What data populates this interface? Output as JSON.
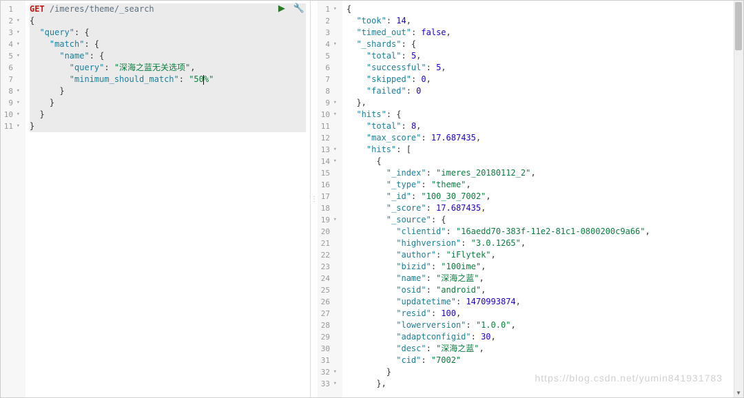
{
  "left": {
    "toolbar": {
      "play": "▶",
      "wrench": "🔧"
    },
    "lines": [
      {
        "n": 1,
        "fold": "",
        "tokens": [
          [
            "method",
            "GET"
          ],
          [
            "text",
            " "
          ],
          [
            "path",
            "/imeres/theme/_search"
          ]
        ]
      },
      {
        "n": 2,
        "fold": "▾",
        "tokens": [
          [
            "punct",
            "{"
          ]
        ]
      },
      {
        "n": 3,
        "fold": "▾",
        "tokens": [
          [
            "text",
            "  "
          ],
          [
            "key",
            "\"query\""
          ],
          [
            "punct",
            ": {"
          ]
        ]
      },
      {
        "n": 4,
        "fold": "▾",
        "tokens": [
          [
            "text",
            "    "
          ],
          [
            "key",
            "\"match\""
          ],
          [
            "punct",
            ": {"
          ]
        ]
      },
      {
        "n": 5,
        "fold": "▾",
        "tokens": [
          [
            "text",
            "      "
          ],
          [
            "key",
            "\"name\""
          ],
          [
            "punct",
            ": {"
          ]
        ]
      },
      {
        "n": 6,
        "fold": "",
        "tokens": [
          [
            "text",
            "        "
          ],
          [
            "key",
            "\"query\""
          ],
          [
            "punct",
            ": "
          ],
          [
            "qstr",
            "\"深海之蓝无关选项\""
          ],
          [
            "punct",
            ","
          ]
        ]
      },
      {
        "n": 7,
        "fold": "",
        "cursor": true,
        "tokens": [
          [
            "text",
            "        "
          ],
          [
            "key",
            "\"minimum_should_match\""
          ],
          [
            "punct",
            ": "
          ],
          [
            "qstr",
            "\"50"
          ],
          [
            "cursor",
            ""
          ],
          [
            "qstr",
            "%\""
          ]
        ]
      },
      {
        "n": 8,
        "fold": "▾",
        "tokens": [
          [
            "text",
            "      "
          ],
          [
            "punct",
            "}"
          ]
        ]
      },
      {
        "n": 9,
        "fold": "▾",
        "tokens": [
          [
            "text",
            "    "
          ],
          [
            "punct",
            "}"
          ]
        ]
      },
      {
        "n": 10,
        "fold": "▾",
        "tokens": [
          [
            "text",
            "  "
          ],
          [
            "punct",
            "}"
          ]
        ]
      },
      {
        "n": 11,
        "fold": "▾",
        "tokens": [
          [
            "punct",
            "}"
          ]
        ]
      }
    ]
  },
  "right": {
    "lines": [
      {
        "n": 1,
        "fold": "▾",
        "tokens": [
          [
            "punct",
            "{"
          ]
        ]
      },
      {
        "n": 2,
        "fold": "",
        "tokens": [
          [
            "text",
            "  "
          ],
          [
            "key",
            "\"took\""
          ],
          [
            "punct",
            ": "
          ],
          [
            "num",
            "14"
          ],
          [
            "punct",
            ","
          ]
        ]
      },
      {
        "n": 3,
        "fold": "",
        "tokens": [
          [
            "text",
            "  "
          ],
          [
            "key",
            "\"timed_out\""
          ],
          [
            "punct",
            ": "
          ],
          [
            "bool",
            "false"
          ],
          [
            "punct",
            ","
          ]
        ]
      },
      {
        "n": 4,
        "fold": "▾",
        "tokens": [
          [
            "text",
            "  "
          ],
          [
            "key",
            "\"_shards\""
          ],
          [
            "punct",
            ": {"
          ]
        ]
      },
      {
        "n": 5,
        "fold": "",
        "tokens": [
          [
            "text",
            "    "
          ],
          [
            "key",
            "\"total\""
          ],
          [
            "punct",
            ": "
          ],
          [
            "num",
            "5"
          ],
          [
            "punct",
            ","
          ]
        ]
      },
      {
        "n": 6,
        "fold": "",
        "tokens": [
          [
            "text",
            "    "
          ],
          [
            "key",
            "\"successful\""
          ],
          [
            "punct",
            ": "
          ],
          [
            "num",
            "5"
          ],
          [
            "punct",
            ","
          ]
        ]
      },
      {
        "n": 7,
        "fold": "",
        "tokens": [
          [
            "text",
            "    "
          ],
          [
            "key",
            "\"skipped\""
          ],
          [
            "punct",
            ": "
          ],
          [
            "num",
            "0"
          ],
          [
            "punct",
            ","
          ]
        ]
      },
      {
        "n": 8,
        "fold": "",
        "tokens": [
          [
            "text",
            "    "
          ],
          [
            "key",
            "\"failed\""
          ],
          [
            "punct",
            ": "
          ],
          [
            "num",
            "0"
          ]
        ]
      },
      {
        "n": 9,
        "fold": "▾",
        "tokens": [
          [
            "text",
            "  "
          ],
          [
            "punct",
            "},"
          ]
        ]
      },
      {
        "n": 10,
        "fold": "▾",
        "tokens": [
          [
            "text",
            "  "
          ],
          [
            "key",
            "\"hits\""
          ],
          [
            "punct",
            ": {"
          ]
        ]
      },
      {
        "n": 11,
        "fold": "",
        "tokens": [
          [
            "text",
            "    "
          ],
          [
            "key",
            "\"total\""
          ],
          [
            "punct",
            ": "
          ],
          [
            "num",
            "8"
          ],
          [
            "punct",
            ","
          ]
        ]
      },
      {
        "n": 12,
        "fold": "",
        "tokens": [
          [
            "text",
            "    "
          ],
          [
            "key",
            "\"max_score\""
          ],
          [
            "punct",
            ": "
          ],
          [
            "num",
            "17.687435"
          ],
          [
            "punct",
            ","
          ]
        ]
      },
      {
        "n": 13,
        "fold": "▾",
        "tokens": [
          [
            "text",
            "    "
          ],
          [
            "key",
            "\"hits\""
          ],
          [
            "punct",
            ": ["
          ]
        ]
      },
      {
        "n": 14,
        "fold": "▾",
        "tokens": [
          [
            "text",
            "      "
          ],
          [
            "punct",
            "{"
          ]
        ]
      },
      {
        "n": 15,
        "fold": "",
        "tokens": [
          [
            "text",
            "        "
          ],
          [
            "key",
            "\"_index\""
          ],
          [
            "punct",
            ": "
          ],
          [
            "qstr",
            "\"imeres_20180112_2\""
          ],
          [
            "punct",
            ","
          ]
        ]
      },
      {
        "n": 16,
        "fold": "",
        "tokens": [
          [
            "text",
            "        "
          ],
          [
            "key",
            "\"_type\""
          ],
          [
            "punct",
            ": "
          ],
          [
            "qstr",
            "\"theme\""
          ],
          [
            "punct",
            ","
          ]
        ]
      },
      {
        "n": 17,
        "fold": "",
        "tokens": [
          [
            "text",
            "        "
          ],
          [
            "key",
            "\"_id\""
          ],
          [
            "punct",
            ": "
          ],
          [
            "qstr",
            "\"100_30_7002\""
          ],
          [
            "punct",
            ","
          ]
        ]
      },
      {
        "n": 18,
        "fold": "",
        "tokens": [
          [
            "text",
            "        "
          ],
          [
            "key",
            "\"_score\""
          ],
          [
            "punct",
            ": "
          ],
          [
            "num",
            "17.687435"
          ],
          [
            "punct",
            ","
          ]
        ]
      },
      {
        "n": 19,
        "fold": "▾",
        "tokens": [
          [
            "text",
            "        "
          ],
          [
            "key",
            "\"_source\""
          ],
          [
            "punct",
            ": {"
          ]
        ]
      },
      {
        "n": 20,
        "fold": "",
        "tokens": [
          [
            "text",
            "          "
          ],
          [
            "key",
            "\"clientid\""
          ],
          [
            "punct",
            ": "
          ],
          [
            "qstr",
            "\"16aedd70-383f-11e2-81c1-0800200c9a66\""
          ],
          [
            "punct",
            ","
          ]
        ]
      },
      {
        "n": 21,
        "fold": "",
        "tokens": [
          [
            "text",
            "          "
          ],
          [
            "key",
            "\"highversion\""
          ],
          [
            "punct",
            ": "
          ],
          [
            "qstr",
            "\"3.0.1265\""
          ],
          [
            "punct",
            ","
          ]
        ]
      },
      {
        "n": 22,
        "fold": "",
        "tokens": [
          [
            "text",
            "          "
          ],
          [
            "key",
            "\"author\""
          ],
          [
            "punct",
            ": "
          ],
          [
            "qstr",
            "\"iFlytek\""
          ],
          [
            "punct",
            ","
          ]
        ]
      },
      {
        "n": 23,
        "fold": "",
        "tokens": [
          [
            "text",
            "          "
          ],
          [
            "key",
            "\"bizid\""
          ],
          [
            "punct",
            ": "
          ],
          [
            "qstr",
            "\"100ime\""
          ],
          [
            "punct",
            ","
          ]
        ]
      },
      {
        "n": 24,
        "fold": "",
        "tokens": [
          [
            "text",
            "          "
          ],
          [
            "key",
            "\"name\""
          ],
          [
            "punct",
            ": "
          ],
          [
            "qstr",
            "\"深海之蓝\""
          ],
          [
            "punct",
            ","
          ]
        ]
      },
      {
        "n": 25,
        "fold": "",
        "tokens": [
          [
            "text",
            "          "
          ],
          [
            "key",
            "\"osid\""
          ],
          [
            "punct",
            ": "
          ],
          [
            "qstr",
            "\"android\""
          ],
          [
            "punct",
            ","
          ]
        ]
      },
      {
        "n": 26,
        "fold": "",
        "tokens": [
          [
            "text",
            "          "
          ],
          [
            "key",
            "\"updatetime\""
          ],
          [
            "punct",
            ": "
          ],
          [
            "num",
            "1470993874"
          ],
          [
            "punct",
            ","
          ]
        ]
      },
      {
        "n": 27,
        "fold": "",
        "tokens": [
          [
            "text",
            "          "
          ],
          [
            "key",
            "\"resid\""
          ],
          [
            "punct",
            ": "
          ],
          [
            "num",
            "100"
          ],
          [
            "punct",
            ","
          ]
        ]
      },
      {
        "n": 28,
        "fold": "",
        "tokens": [
          [
            "text",
            "          "
          ],
          [
            "key",
            "\"lowerversion\""
          ],
          [
            "punct",
            ": "
          ],
          [
            "qstr",
            "\"1.0.0\""
          ],
          [
            "punct",
            ","
          ]
        ]
      },
      {
        "n": 29,
        "fold": "",
        "tokens": [
          [
            "text",
            "          "
          ],
          [
            "key",
            "\"adaptconfigid\""
          ],
          [
            "punct",
            ": "
          ],
          [
            "num",
            "30"
          ],
          [
            "punct",
            ","
          ]
        ]
      },
      {
        "n": 30,
        "fold": "",
        "tokens": [
          [
            "text",
            "          "
          ],
          [
            "key",
            "\"desc\""
          ],
          [
            "punct",
            ": "
          ],
          [
            "qstr",
            "\"深海之蓝\""
          ],
          [
            "punct",
            ","
          ]
        ]
      },
      {
        "n": 31,
        "fold": "",
        "tokens": [
          [
            "text",
            "          "
          ],
          [
            "key",
            "\"cid\""
          ],
          [
            "punct",
            ": "
          ],
          [
            "qstr",
            "\"7002\""
          ]
        ]
      },
      {
        "n": 32,
        "fold": "▾",
        "tokens": [
          [
            "text",
            "        "
          ],
          [
            "punct",
            "}"
          ]
        ]
      },
      {
        "n": 33,
        "fold": "▾",
        "tokens": [
          [
            "text",
            "      "
          ],
          [
            "punct",
            "},"
          ]
        ]
      }
    ]
  },
  "watermark": "https://blog.csdn.net/yumin841931783"
}
